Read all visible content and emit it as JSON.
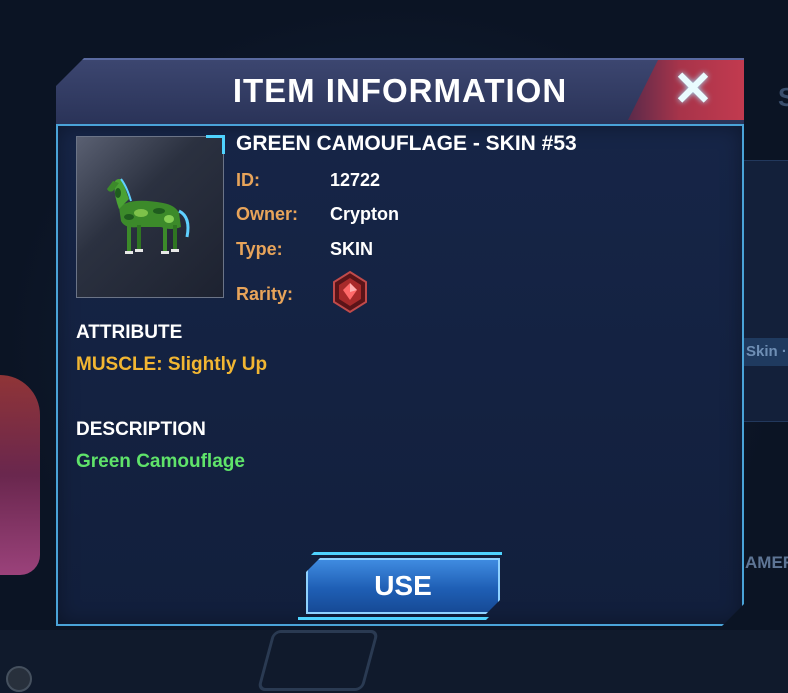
{
  "background": {
    "skin_tag": "Skin ·",
    "side_label": "AMER",
    "corner_letter": "S"
  },
  "dialog": {
    "title": "ITEM INFORMATION",
    "close_symbol": "✕"
  },
  "item": {
    "name": "GREEN CAMOUFLAGE - SKIN #53",
    "fields": {
      "id_label": "ID:",
      "id_value": "12722",
      "owner_label": "Owner:",
      "owner_value": "Crypton",
      "type_label": "Type:",
      "type_value": "SKIN",
      "rarity_label": "Rarity:"
    },
    "rarity_icon": "red-gem-badge-icon",
    "thumbnail_icon": "green-camouflage-horse-icon"
  },
  "attribute": {
    "title": "ATTRIBUTE",
    "value": "MUSCLE: Slightly Up"
  },
  "description": {
    "title": "DESCRIPTION",
    "value": "Green Camouflage"
  },
  "actions": {
    "use_label": "USE"
  },
  "colors": {
    "label_orange": "#e8a45a",
    "attribute_gold": "#f2b632",
    "description_green": "#5fe36a",
    "accent_cyan": "#4fd3ff",
    "close_red": "#c23a4f"
  }
}
